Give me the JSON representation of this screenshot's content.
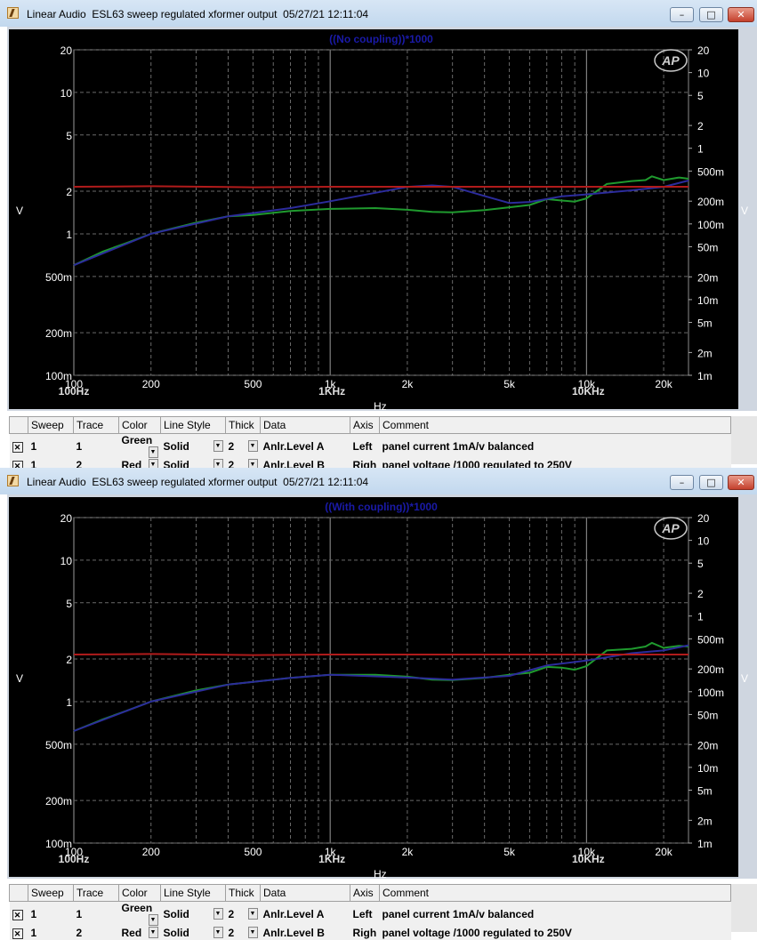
{
  "windows": [
    {
      "title": "Linear Audio  ESL63 sweep regulated xformer output  05/27/21 12:11:04",
      "chart_title": "((No coupling))*1000",
      "units_left": "V",
      "units_right": "V",
      "xlabel": "Hz"
    },
    {
      "title": "Linear Audio  ESL63 sweep regulated xformer output  05/27/21 12:11:04",
      "chart_title": "((With coupling))*1000",
      "units_left": "V",
      "units_right": "V",
      "xlabel": "Hz"
    }
  ],
  "window_buttons": {
    "minimize": "–",
    "maximize": "□",
    "close": "✕"
  },
  "chart_data": [
    {
      "type": "line",
      "title": "((No coupling))*1000",
      "xlabel": "Hz",
      "ylabel": "V",
      "xscale": "log",
      "xlim": [
        100,
        25000
      ],
      "ylim_left": [
        0.1,
        20
      ],
      "ylim_right": [
        0.001,
        20
      ],
      "yscale": "log",
      "grid": true,
      "x_tick_labels": [
        "100",
        "200",
        "500",
        "1k",
        "2k",
        "5k",
        "10k",
        "20k"
      ],
      "x_decade_labels": [
        "100Hz",
        "1KHz",
        "10KHz"
      ],
      "y_left_tick_labels": [
        "20",
        "10",
        "5",
        "2",
        "1",
        "500m",
        "200m",
        "100m"
      ],
      "y_right_tick_labels": [
        "20",
        "10",
        "5",
        "2",
        "1",
        "500m",
        "200m",
        "100m",
        "50m",
        "20m",
        "10m",
        "5m",
        "2m",
        "1m"
      ],
      "series": [
        {
          "color": "#1f9a2e",
          "axis": "left",
          "points": [
            [
              100,
              0.6
            ],
            [
              130,
              0.75
            ],
            [
              160,
              0.86
            ],
            [
              200,
              1.0
            ],
            [
              300,
              1.2
            ],
            [
              400,
              1.33
            ],
            [
              500,
              1.36
            ],
            [
              700,
              1.45
            ],
            [
              1000,
              1.5
            ],
            [
              1500,
              1.52
            ],
            [
              2000,
              1.48
            ],
            [
              2500,
              1.43
            ],
            [
              3000,
              1.42
            ],
            [
              4000,
              1.47
            ],
            [
              5000,
              1.54
            ],
            [
              6000,
              1.6
            ],
            [
              7000,
              1.76
            ],
            [
              8000,
              1.72
            ],
            [
              9000,
              1.69
            ],
            [
              10000,
              1.78
            ],
            [
              12000,
              2.25
            ],
            [
              15000,
              2.36
            ],
            [
              17000,
              2.4
            ],
            [
              18000,
              2.55
            ],
            [
              20000,
              2.4
            ],
            [
              23000,
              2.5
            ],
            [
              25000,
              2.45
            ]
          ]
        },
        {
          "color": "#2c2c9c",
          "axis": "left",
          "points": [
            [
              100,
              0.6
            ],
            [
              200,
              1.0
            ],
            [
              400,
              1.33
            ],
            [
              700,
              1.52
            ],
            [
              1000,
              1.7
            ],
            [
              1500,
              1.95
            ],
            [
              2000,
              2.15
            ],
            [
              2500,
              2.2
            ],
            [
              3000,
              2.15
            ],
            [
              4000,
              1.85
            ],
            [
              5000,
              1.65
            ],
            [
              6000,
              1.68
            ],
            [
              8000,
              1.84
            ],
            [
              10000,
              1.9
            ],
            [
              15000,
              2.03
            ],
            [
              20000,
              2.15
            ],
            [
              25000,
              2.38
            ]
          ]
        },
        {
          "color": "#b01b1b",
          "axis": "right",
          "points": [
            [
              100,
              0.31
            ],
            [
              200,
              0.315
            ],
            [
              500,
              0.305
            ],
            [
              1000,
              0.31
            ],
            [
              2000,
              0.31
            ],
            [
              5000,
              0.31
            ],
            [
              10000,
              0.31
            ],
            [
              25000,
              0.31
            ]
          ]
        }
      ]
    },
    {
      "type": "line",
      "title": "((With coupling))*1000",
      "xlabel": "Hz",
      "ylabel": "V",
      "xscale": "log",
      "xlim": [
        100,
        25000
      ],
      "ylim_left": [
        0.1,
        20
      ],
      "ylim_right": [
        0.001,
        20
      ],
      "yscale": "log",
      "grid": true,
      "x_tick_labels": [
        "100",
        "200",
        "500",
        "1k",
        "2k",
        "5k",
        "10k",
        "20k"
      ],
      "x_decade_labels": [
        "100Hz",
        "1KHz",
        "10KHz"
      ],
      "y_left_tick_labels": [
        "20",
        "10",
        "5",
        "2",
        "1",
        "500m",
        "200m",
        "100m"
      ],
      "y_right_tick_labels": [
        "20",
        "10",
        "5",
        "2",
        "1",
        "500m",
        "200m",
        "100m",
        "50m",
        "20m",
        "10m",
        "5m",
        "2m",
        "1m"
      ],
      "series": [
        {
          "color": "#1f9a2e",
          "axis": "left",
          "points": [
            [
              100,
              0.62
            ],
            [
              130,
              0.75
            ],
            [
              160,
              0.86
            ],
            [
              200,
              1.0
            ],
            [
              300,
              1.2
            ],
            [
              400,
              1.32
            ],
            [
              500,
              1.38
            ],
            [
              700,
              1.47
            ],
            [
              1000,
              1.55
            ],
            [
              1500,
              1.55
            ],
            [
              2000,
              1.5
            ],
            [
              2500,
              1.43
            ],
            [
              3000,
              1.42
            ],
            [
              4000,
              1.47
            ],
            [
              5000,
              1.55
            ],
            [
              6000,
              1.6
            ],
            [
              7000,
              1.76
            ],
            [
              8000,
              1.74
            ],
            [
              9000,
              1.68
            ],
            [
              10000,
              1.78
            ],
            [
              12000,
              2.3
            ],
            [
              15000,
              2.36
            ],
            [
              17000,
              2.45
            ],
            [
              18000,
              2.6
            ],
            [
              20000,
              2.4
            ],
            [
              23000,
              2.48
            ],
            [
              25000,
              2.45
            ]
          ]
        },
        {
          "color": "#2c2c9c",
          "axis": "left",
          "points": [
            [
              100,
              0.62
            ],
            [
              200,
              1.0
            ],
            [
              400,
              1.32
            ],
            [
              700,
              1.47
            ],
            [
              1000,
              1.55
            ],
            [
              2000,
              1.48
            ],
            [
              3000,
              1.43
            ],
            [
              5000,
              1.52
            ],
            [
              7000,
              1.8
            ],
            [
              10000,
              1.95
            ],
            [
              15000,
              2.2
            ],
            [
              20000,
              2.3
            ],
            [
              25000,
              2.5
            ]
          ]
        },
        {
          "color": "#b01b1b",
          "axis": "right",
          "points": [
            [
              100,
              0.31
            ],
            [
              200,
              0.315
            ],
            [
              500,
              0.305
            ],
            [
              1000,
              0.31
            ],
            [
              2000,
              0.31
            ],
            [
              5000,
              0.31
            ],
            [
              10000,
              0.31
            ],
            [
              25000,
              0.31
            ]
          ]
        }
      ]
    }
  ],
  "tables": [
    {
      "headers": [
        "",
        "Sweep",
        "Trace",
        "Color",
        "Line Style",
        "Thick",
        "Data",
        "Axis",
        "Comment"
      ],
      "rows": [
        {
          "checked": "✕",
          "sweep": "1",
          "trace": "1",
          "color": "Green",
          "line_style": "Solid",
          "thick": "2",
          "data": "Anlr.Level A",
          "axis": "Left",
          "comment": "panel current 1mA/v balanced"
        },
        {
          "checked": "✕",
          "sweep": "1",
          "trace": "2",
          "color": "Red",
          "line_style": "Solid",
          "thick": "2",
          "data": "Anlr.Level B",
          "axis": "Righ",
          "comment": "panel voltage /1000 regulated to 250V"
        }
      ]
    },
    {
      "headers": [
        "",
        "Sweep",
        "Trace",
        "Color",
        "Line Style",
        "Thick",
        "Data",
        "Axis",
        "Comment"
      ],
      "rows": [
        {
          "checked": "✕",
          "sweep": "1",
          "trace": "1",
          "color": "Green",
          "line_style": "Solid",
          "thick": "2",
          "data": "Anlr.Level A",
          "axis": "Left",
          "comment": "panel current 1mA/v balanced"
        },
        {
          "checked": "✕",
          "sweep": "1",
          "trace": "2",
          "color": "Red",
          "line_style": "Solid",
          "thick": "2",
          "data": "Anlr.Level B",
          "axis": "Righ",
          "comment": "panel voltage /1000 regulated to 250V"
        }
      ]
    }
  ],
  "logo_text": "AP"
}
